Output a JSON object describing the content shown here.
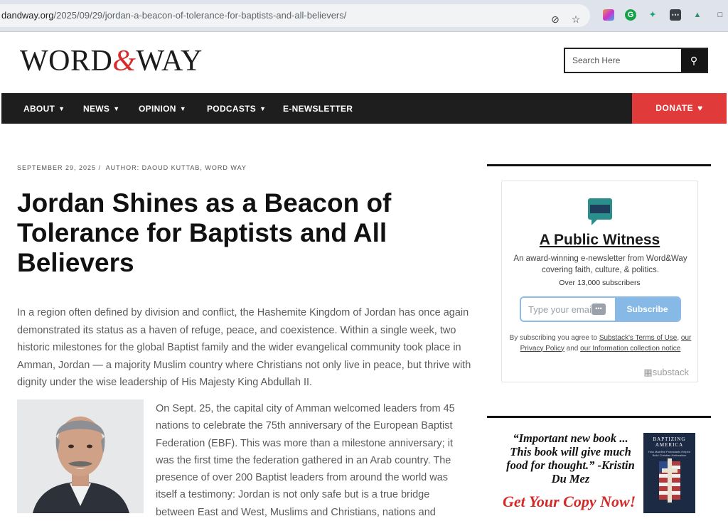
{
  "browser": {
    "url_domain": "dandway.org",
    "url_path": "/2025/09/29/jordan-a-beacon-of-tolerance-for-baptists-and-all-believers/"
  },
  "site": {
    "logo_left": "WORD",
    "logo_amp": "&",
    "logo_right": "WAY",
    "search_placeholder": "Search Here"
  },
  "nav": {
    "items": [
      {
        "label": "ABOUT",
        "has_dropdown": true
      },
      {
        "label": "NEWS",
        "has_dropdown": true
      },
      {
        "label": "OPINION",
        "has_dropdown": true
      },
      {
        "label": "PODCASTS",
        "has_dropdown": true
      },
      {
        "label": "E-NEWSLETTER",
        "has_dropdown": false
      }
    ],
    "donate_label": "DONATE",
    "donate_color": "#e03a3a"
  },
  "article": {
    "date": "SEPTEMBER 29, 2025",
    "separator": "/",
    "author": "AUTHOR: DAOUD KUTTAB, WORD WAY",
    "title": "Jordan Shines as a Beacon of Tolerance for Baptists and All Believers",
    "lead": "In a region often defined by division and conflict, the Hashemite Kingdom of Jordan has once again demonstrated its status as a haven of refuge, peace, and coexistence. Within a single week, two historic milestones for the global Baptist family and the wider evangelical community took place in Amman, Jordan — a majority Muslim country where Christians not only live in peace, but thrive with dignity under the wise leadership of His Majesty King Abdullah II.",
    "para2": "On Sept. 25, the capital city of Amman welcomed leaders from 45 nations to celebrate the 75th anniversary of the European Baptist Federation (EBF). This was more than a milestone anniversary; it was the first time the federation gathered in an Arab country. The presence of over 200 Baptist leaders from around the world was itself a testimony: Jordan is not only safe but is a true bridge between East and West, Muslims and Christians, nations and"
  },
  "newsletter": {
    "logo_text": "A PUBLIC WITNESS",
    "title": "A Public Witness",
    "description": "An award-winning e-newsletter from Word&Way covering faith, culture, & politics.",
    "subscribers": "Over 13,000 subscribers",
    "email_placeholder": "Type your email...",
    "subscribe_label": "Subscribe",
    "legal_prefix": "By subscribing you agree to ",
    "terms_link": "Substack's Terms of Use",
    "legal_sep1": ", ",
    "privacy_link": "our Privacy Policy",
    "legal_and": " and ",
    "info_link": "our Information collection notice",
    "substack_brand": "substack"
  },
  "ad": {
    "quote": "“Important new book ... This book will give much food for thought.” -Kristin Du Mez",
    "cta": "Get Your Copy Now!",
    "book_title": "BAPTIZING AMERICA",
    "book_subtitle": "How Mainline Protestants Helped Build Christian Nationalism"
  }
}
